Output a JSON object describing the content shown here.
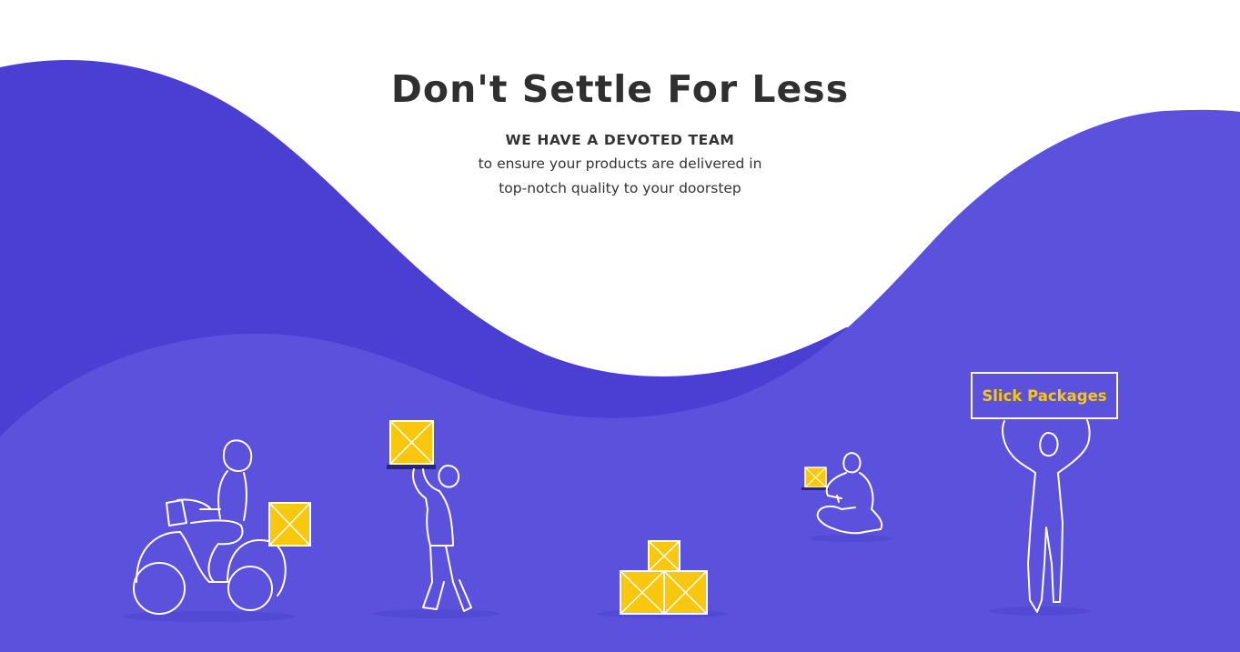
{
  "hero": {
    "headline": "Don't Settle For Less",
    "subheading": "WE HAVE A DEVOTED TEAM",
    "line1": "to ensure your products are delivered in",
    "line2": "top-notch quality to your doorstep"
  },
  "sign": {
    "label": "Slick Packages"
  },
  "colors": {
    "wave_dark": "#4a3ed3",
    "wave_light": "#5b51dc",
    "accent_yellow": "#f9c80e",
    "outline": "#ffffff",
    "text": "#2f2f2f"
  },
  "illustrations": [
    "scooter-rider-icon",
    "person-carrying-box-icon",
    "stacked-boxes-icon",
    "sitting-person-box-icon",
    "person-holding-sign-icon"
  ]
}
